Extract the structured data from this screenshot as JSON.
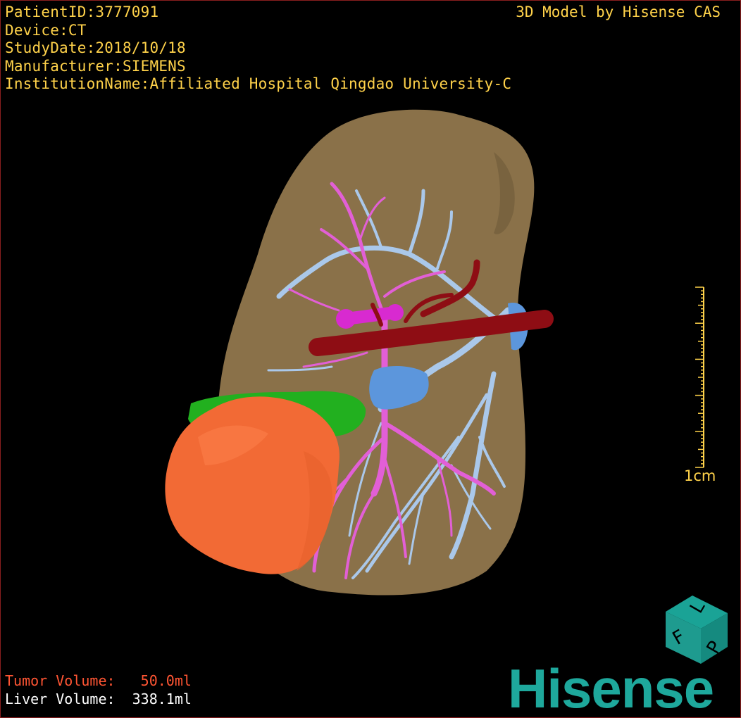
{
  "patient_info": {
    "patient_id": "PatientID:3777091",
    "device": "Device:CT",
    "study_date": "StudyDate:2018/10/18",
    "manufacturer": "Manufacturer:SIEMENS",
    "institution": "InstitutionName:Affiliated Hospital Qingdao University-C"
  },
  "credit": "3D Model by Hisense CAS",
  "volumes": {
    "tumor": "Tumor Volume:   50.0ml",
    "liver": "Liver Volume:  338.1ml"
  },
  "scale": {
    "label": "1cm"
  },
  "orientation_cube": {
    "face_top": "L",
    "face_right": "P",
    "face_left": "F"
  },
  "logo": "Hisense",
  "colors": {
    "info_text": "#ffd24a",
    "tumor_text": "#ff5533",
    "liver_text": "#ffffff",
    "liver": "#8a7149",
    "tumor": "#f26a35",
    "portal_vein": "#e25fd6",
    "hepatic_vein": "#aac8ea",
    "artery": "#8e0d14",
    "segment": "#22b01f",
    "logo": "#1ea89c",
    "border": "#8a1f1f"
  }
}
